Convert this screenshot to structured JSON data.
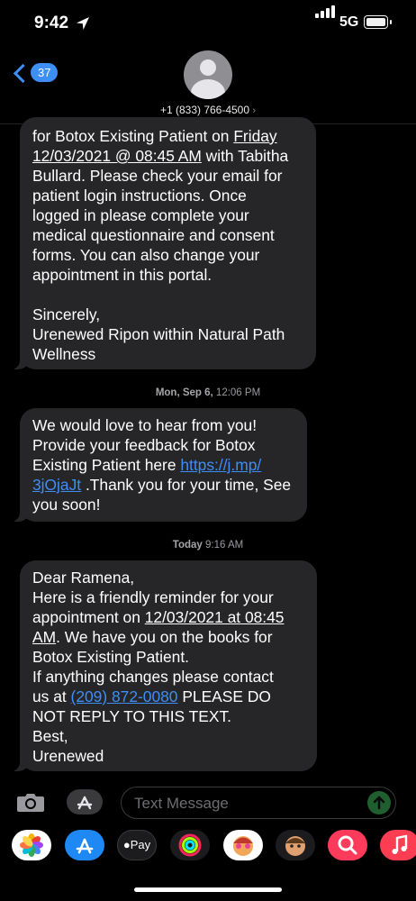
{
  "status": {
    "time": "9:42",
    "network": "5G"
  },
  "header": {
    "back_count": "37",
    "contact": "+1 (833) 766-4500"
  },
  "messages": {
    "m1": {
      "l1": "for Botox Existing Patient on ",
      "l1_date": "Friday",
      "l2_date": "12/03/2021 @ 08:45 AM",
      "l2_rest": " with Tabitha",
      "l3": "Bullard. Please check your email for",
      "l4": "patient login instructions. Once",
      "l5": "logged in please complete your",
      "l6": "medical questionnaire and consent",
      "l7": "forms. You can also change your",
      "l8": "appointment in this portal.",
      "l9": "Sincerely,",
      "l10": "Urenewed Ripon within Natural Path",
      "l11": "Wellness"
    },
    "stamp2_day": "Mon, Sep 6,",
    "stamp2_time": " 12:06 PM",
    "m2": {
      "l1": "We would love to hear from you!",
      "l2": "Provide your feedback for Botox",
      "l3": "Existing Patient here ",
      "link_a": "https://j.mp/",
      "link_b": "3jOjaJt",
      "l4_rest": " .Thank you for your time, See",
      "l5": "you soon!"
    },
    "stamp3_day": "Today",
    "stamp3_time": " 9:16 AM",
    "m3": {
      "l1": "Dear Ramena,",
      "l2": "Here is a friendly reminder for your",
      "l3": "appointment on ",
      "l3_date": "12/03/2021 at 08:45",
      "l4_date": "AM",
      "l4_rest": ". We have you on the books for",
      "l5": "Botox Existing Patient.",
      "l6": "If anything changes please contact",
      "l7": "us at ",
      "phone": "(209) 872-0080",
      "l7_rest": "  PLEASE DO",
      "l8": "NOT REPLY TO THIS TEXT.",
      "l9": "Best,",
      "l10": "Urenewed"
    }
  },
  "composer": {
    "placeholder": "Text Message"
  },
  "app_strip": {
    "icons": [
      "photos-icon",
      "app-store-icon",
      "apple-pay-icon",
      "fitness-icon",
      "memoji-icon",
      "memoji-icon",
      "images-search-icon",
      "music-icon"
    ],
    "apple_pay_label": "Pay"
  },
  "colors": {
    "bubble": "#262628",
    "link": "#3e8ef7",
    "background": "#000000"
  }
}
